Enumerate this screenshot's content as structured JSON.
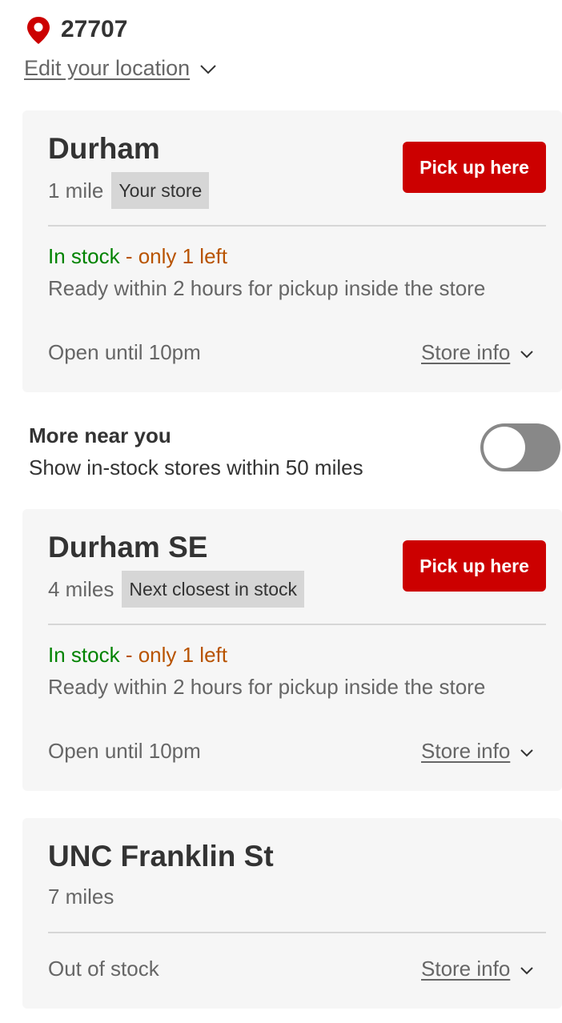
{
  "location": {
    "zip": "27707",
    "edit_label": "Edit your location",
    "pin_icon": "location-pin-icon",
    "pin_color": "#cc0000"
  },
  "stores": [
    {
      "name": "Durham",
      "distance": "1 mile",
      "badge": "Your store",
      "pickup_label": "Pick up here",
      "stock_status": "In stock",
      "stock_separator": " - ",
      "stock_note": "only 1 left",
      "ready_text": "Ready within 2 hours for pickup inside the store",
      "hours": "Open until 10pm",
      "store_info_label": "Store info"
    },
    {
      "name": "Durham SE",
      "distance": "4 miles",
      "badge": "Next closest in stock",
      "pickup_label": "Pick up here",
      "stock_status": "In stock",
      "stock_separator": " - ",
      "stock_note": "only 1 left",
      "ready_text": "Ready within 2 hours for pickup inside the store",
      "hours": "Open until 10pm",
      "store_info_label": "Store info"
    },
    {
      "name": "UNC Franklin St",
      "distance": "7 miles",
      "stock_status": "Out of stock",
      "store_info_label": "Store info"
    }
  ],
  "more_near_you": {
    "title": "More near you",
    "subtitle": "Show in-stock stores within 50 miles",
    "toggle_on": false
  },
  "colors": {
    "primary_red": "#cc0000",
    "in_stock_green": "#008300",
    "low_stock_orange": "#b85300",
    "card_bg": "#f6f6f6",
    "badge_bg": "#d6d6d6"
  }
}
